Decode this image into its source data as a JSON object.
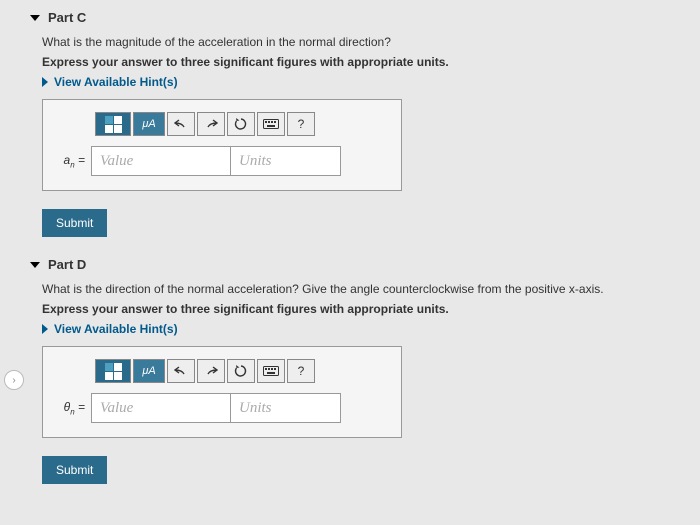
{
  "partC": {
    "title": "Part C",
    "question": "What is the magnitude of the acceleration in the normal direction?",
    "instruction": "Express your answer to three significant figures with appropriate units.",
    "hints_label": "View Available Hint(s)",
    "variable_base": "a",
    "variable_sub": "n",
    "equals": "=",
    "value_placeholder": "Value",
    "units_placeholder": "Units",
    "units_btn_label": "μA",
    "help_label": "?",
    "submit_label": "Submit"
  },
  "partD": {
    "title": "Part D",
    "question": "What is the direction of the normal acceleration? Give the angle counterclockwise from the positive x-axis.",
    "instruction": "Express your answer to three significant figures with appropriate units.",
    "hints_label": "View Available Hint(s)",
    "variable_base": "θ",
    "variable_sub": "n",
    "equals": "=",
    "value_placeholder": "Value",
    "units_placeholder": "Units",
    "units_btn_label": "μA",
    "help_label": "?",
    "submit_label": "Submit"
  }
}
